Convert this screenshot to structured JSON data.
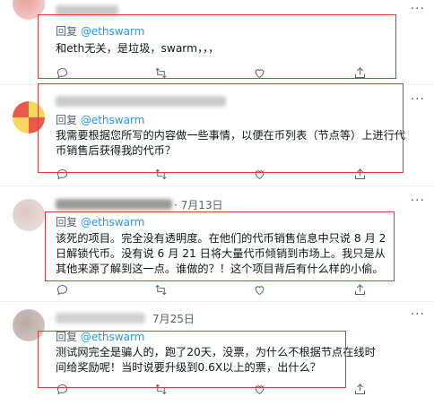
{
  "tweets": [
    {
      "reply_prefix": "回复",
      "handle": "@ethswarm",
      "date": "",
      "text": "和eth无关，是垃圾，swarm，，，",
      "avatar_colors": [
        "#e9a3a0",
        "#f3d7d2"
      ]
    },
    {
      "reply_prefix": "回复",
      "handle": "@ethswarm",
      "date": "",
      "text": "我需要根据您所写的内容做一些事情，以便在币列表（节点等）上进行代币销售后获得我的代币？",
      "avatar_colors": [
        "#f4d75b",
        "#e85b4a"
      ]
    },
    {
      "reply_prefix": "回复",
      "handle": "@ethswarm",
      "date": "· 7月13日",
      "text": "该死的项目。完全没有透明度。在他们的代币销售信息中只说 8 月 2 日解锁代币。没有说 6 月 21 日将大量代币倾销到市场上。我只是从其他来源了解到这一点。谁做的？！这个项目背后有什么样的小偷。",
      "avatar_colors": [
        "#d9c7c2",
        "#efe3df"
      ]
    },
    {
      "reply_prefix": "回复",
      "handle": "@ethswarm",
      "date": "7月25日",
      "text": "测试网完全是骗人的，跑了20天，没票，为什么不根据节点在线时间给奖励呢！当时说要升级到0.6X以上的票，出什么？",
      "avatar_colors": [
        "#b8a9a3",
        "#d8ccc7"
      ]
    }
  ],
  "icons": {
    "reply": "reply-icon",
    "retweet": "retweet-icon",
    "like": "like-icon",
    "share": "share-icon",
    "more": "more-icon"
  },
  "colors": {
    "handle": "#1d9bf0",
    "highlight": "#e23a3a",
    "muted": "#536471"
  }
}
